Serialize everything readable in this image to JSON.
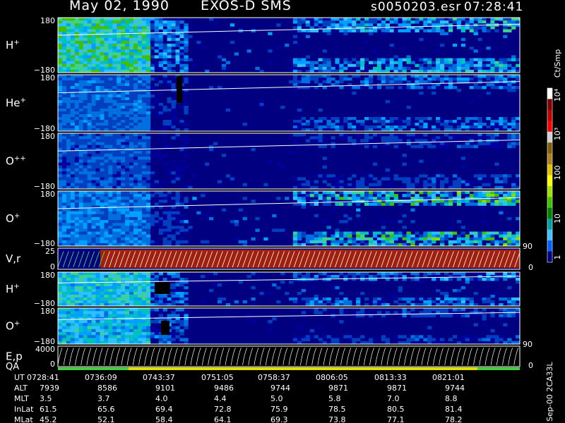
{
  "header": {
    "date": "May 02, 1990",
    "instrument": "EXOS-D SMS",
    "file": "s0050203.esr",
    "time": "07:28:41"
  },
  "panels": [
    {
      "label": "H",
      "sup": "+",
      "top_tick": "180",
      "bottom_tick": "−180"
    },
    {
      "label": "He",
      "sup": "+",
      "top_tick": "180",
      "bottom_tick": "−180"
    },
    {
      "label": "O",
      "sup": "++",
      "top_tick": "180",
      "bottom_tick": "−180"
    },
    {
      "label": "O",
      "sup": "+",
      "top_tick": "180",
      "bottom_tick": "−180"
    },
    {
      "label": "V,r",
      "sup": "",
      "top_tick": "25",
      "bottom_tick": "0"
    },
    {
      "label": "H",
      "sup": "+",
      "top_tick": "180",
      "bottom_tick": "−180"
    },
    {
      "label": "O",
      "sup": "+",
      "top_tick": "180",
      "bottom_tick": "−180"
    },
    {
      "label": "E,p",
      "sup": "",
      "top_tick": "4000",
      "bottom_tick": "0"
    }
  ],
  "qa_label": "QA",
  "right_axes": {
    "vr": {
      "top": "90",
      "bottom": "0"
    },
    "ep": {
      "top": "90",
      "bottom": "0"
    }
  },
  "colorbar": {
    "unit": "Ct/Smp",
    "labels": [
      "10⁴",
      "10³",
      "100",
      "10",
      "1"
    ],
    "colors": [
      "#ffffff",
      "#800000",
      "#c00000",
      "#ff0000",
      "#d0d0d0",
      "#806010",
      "#b08020",
      "#e0c000",
      "#ffff00",
      "#a0e000",
      "#40c000",
      "#008000",
      "#00a0a0",
      "#40c0ff",
      "#0060ff",
      "#000080"
    ]
  },
  "footer": {
    "rows": [
      {
        "name": "UT",
        "values": [
          "0728:41",
          "0736:09",
          "0743:37",
          "0751:05",
          "0758:37",
          "0806:05",
          "0813:33",
          "0821:01"
        ]
      },
      {
        "name": "ALT",
        "values": [
          "7939",
          "8586",
          "9101",
          "9486",
          "9744",
          "9871",
          "9871",
          "9744"
        ]
      },
      {
        "name": "MLT",
        "values": [
          "3.5",
          "3.7",
          "4.0",
          "4.4",
          "5.0",
          "5.8",
          "7.0",
          "8.8"
        ]
      },
      {
        "name": "InLat",
        "values": [
          "61.5",
          "65.6",
          "69.4",
          "72.8",
          "75.9",
          "78.5",
          "80.5",
          "81.4"
        ]
      },
      {
        "name": "MLat",
        "values": [
          "45.2",
          "52.1",
          "58.4",
          "64.1",
          "69.3",
          "73.8",
          "77.1",
          "78.2"
        ]
      }
    ],
    "side_note": "Sep-00 2CA33L"
  },
  "chart_data": {
    "type": "heatmap",
    "x_ticks": [
      "0728:41",
      "0736:09",
      "0743:37",
      "0751:05",
      "0758:37",
      "0806:05",
      "0813:33",
      "0821:01"
    ],
    "panels": [
      "H+",
      "He+",
      "O++",
      "O+",
      "V,r",
      "H+",
      "O+",
      "E,p"
    ],
    "y_range_pitch": [
      -180,
      180
    ],
    "colorbar_scale": "log",
    "colorbar_range": [
      1,
      10000
    ],
    "colorbar_unit": "Ct/Smp"
  }
}
